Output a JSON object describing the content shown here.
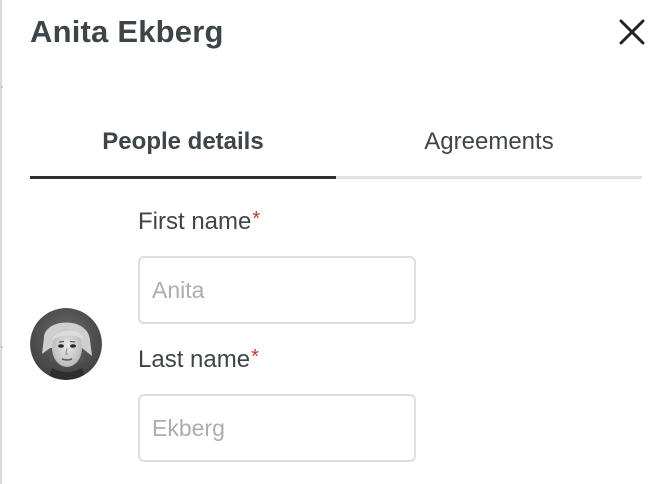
{
  "header": {
    "title": "Anita Ekberg",
    "close_icon": "close-icon"
  },
  "tabs": [
    {
      "label": "People details",
      "active": true
    },
    {
      "label": "Agreements",
      "active": false
    }
  ],
  "avatar": {
    "icon": "person-photo-avatar"
  },
  "form": {
    "first_name": {
      "label": "First name",
      "required_mark": "*",
      "value": "",
      "placeholder": "Anita"
    },
    "last_name": {
      "label": "Last name",
      "required_mark": "*",
      "value": "",
      "placeholder": "Ekberg"
    }
  },
  "colors": {
    "text": "#3d4549",
    "required": "#c0392b",
    "active_tab_underline": "#2b3135",
    "tab_underline": "#e3e3e3",
    "input_border": "#dedede",
    "placeholder": "#a9aeb1"
  }
}
